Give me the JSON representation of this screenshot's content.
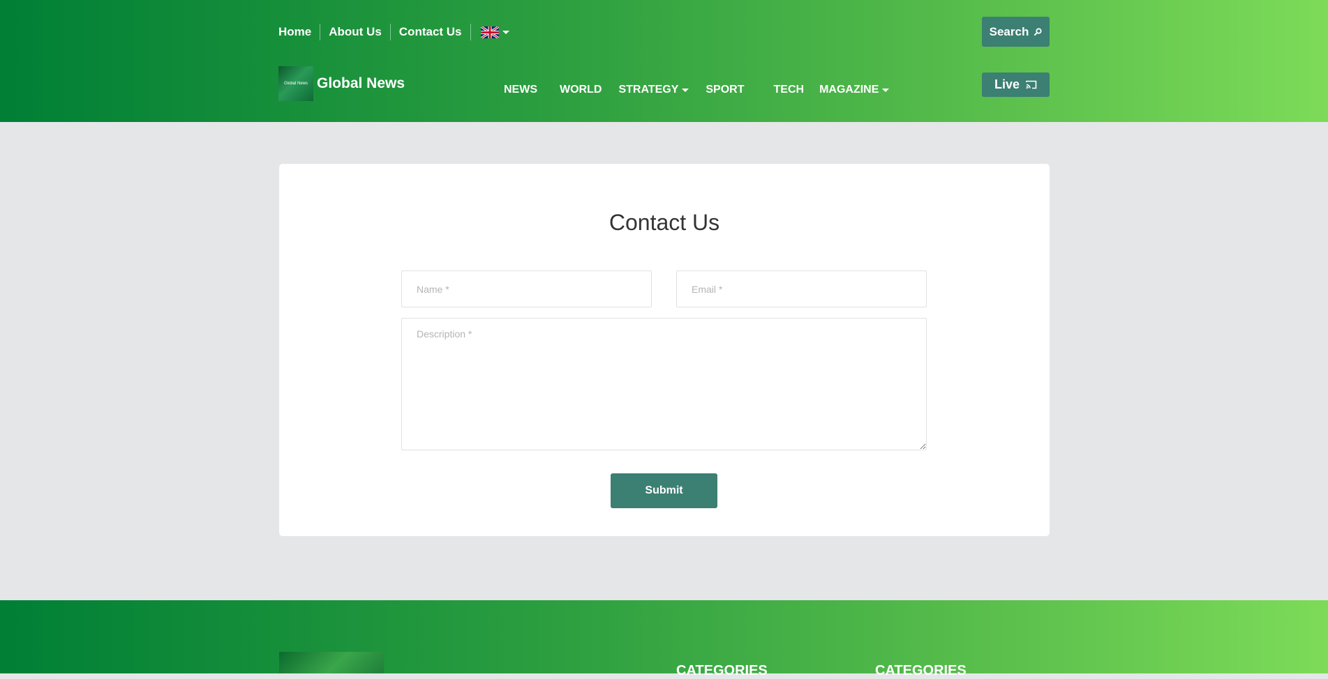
{
  "header": {
    "top_links": [
      "Home",
      "About Us",
      "Contact Us"
    ],
    "search_label": "Search",
    "logo_image_text": "Global News",
    "site_name": "Global News",
    "nav": [
      {
        "label": "NEWS",
        "dropdown": false
      },
      {
        "label": "WORLD",
        "dropdown": false
      },
      {
        "label": "STRATEGY",
        "dropdown": true
      },
      {
        "label": "SPORT",
        "dropdown": false
      },
      {
        "label": "TECH",
        "dropdown": false
      },
      {
        "label": "MAGAZINE",
        "dropdown": true
      }
    ],
    "live_label": "Live"
  },
  "contact": {
    "title": "Contact Us",
    "name_placeholder": "Name *",
    "email_placeholder": "Email *",
    "description_placeholder": "Description *",
    "submit_label": "Submit"
  },
  "footer": {
    "categories_headings": [
      "CATEGORIES",
      "CATEGORIES"
    ]
  },
  "colors": {
    "accent": "#3c7f73",
    "gradient_start": "#007f35",
    "gradient_end": "#7ddb58",
    "page_bg": "#e5e6e8"
  }
}
